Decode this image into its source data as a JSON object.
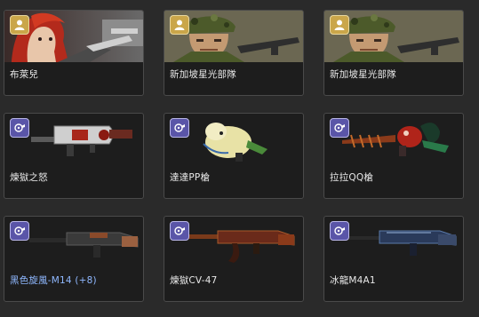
{
  "items": [
    {
      "name": "布萊兒",
      "badge": "character-icon",
      "type": "character"
    },
    {
      "name": "新加坡星光部隊",
      "badge": "character-icon",
      "type": "character"
    },
    {
      "name": "新加坡星光部隊",
      "badge": "character-icon",
      "type": "character"
    },
    {
      "name": "煉獄之怒",
      "badge": "revolver-icon",
      "type": "weapon"
    },
    {
      "name": "達達PP槍",
      "badge": "revolver-icon",
      "type": "weapon"
    },
    {
      "name": "拉拉QQ槍",
      "badge": "revolver-icon",
      "type": "weapon"
    },
    {
      "name": "黑色旋風-M14 (+8)",
      "badge": "revolver-icon",
      "type": "weapon",
      "highlight": true
    },
    {
      "name": "煉獄CV-47",
      "badge": "revolver-icon",
      "type": "weapon"
    },
    {
      "name": "冰龍M4A1",
      "badge": "revolver-icon",
      "type": "weapon"
    }
  ],
  "colors": {
    "highlight_label": "#8fb8ff",
    "character_badge": "#caa64a",
    "weapon_badge": "#5a55a8"
  }
}
